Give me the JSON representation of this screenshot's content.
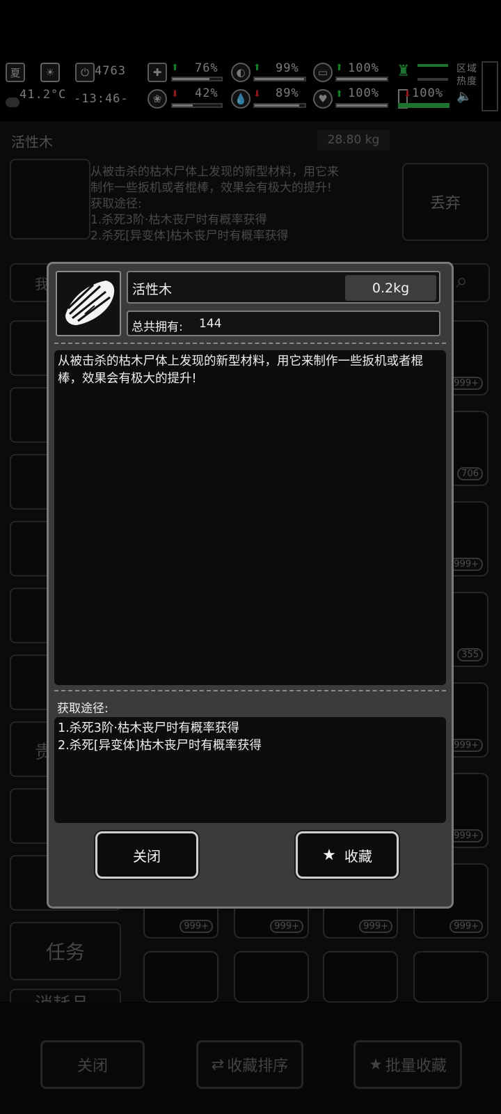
{
  "status": {
    "season": "夏",
    "temperature": "41.2°C",
    "time": "-13:46-",
    "counter": "4763",
    "stats": [
      {
        "icon": "medkit-icon",
        "value": "76%",
        "trend": "up"
      },
      {
        "icon": "stomach-icon",
        "value": "99%",
        "trend": "up"
      },
      {
        "icon": "bandage-icon",
        "value": "100%",
        "trend": "up"
      },
      {
        "icon": "brain-icon",
        "value": "42%",
        "trend": "down"
      },
      {
        "icon": "water-drop-icon",
        "value": "89%",
        "trend": "down"
      },
      {
        "icon": "heart-icon",
        "value": "100%",
        "trend": "up"
      },
      {
        "icon": "battery-icon",
        "value": "100%",
        "trend": "down"
      }
    ],
    "region_heat_label": "区域热度"
  },
  "background": {
    "item_name": "活性木",
    "item_weight": "28.80 kg",
    "desc_lines": [
      "从被击杀的枯木尸体上发现的新型材料，用它来",
      "制作一些扳机或者棍棒，效果会有极大的提升!",
      "获取途径:",
      "1.杀死3阶·枯木丧尸时有概率获得",
      "2.杀死[异变体]枯木丧尸时有概率获得"
    ],
    "discard_label": "丢弃",
    "search_stub": "我",
    "sidebar_task": "任务",
    "sidebar_consumable": "消耗品",
    "sidebar_valuable": "贵",
    "tile_counts": [
      "999+",
      "706",
      "999+",
      "355",
      "999+",
      "999+",
      "999+",
      "999+",
      "999+",
      "999+",
      "999+"
    ],
    "bottom_buttons": {
      "close": "关闭",
      "sort_favorites": "收藏排序",
      "batch_favorite": "批量收藏"
    }
  },
  "dialog": {
    "item_name": "活性木",
    "weight": "0.2kg",
    "owned_label": "总共拥有:",
    "owned_count": "144",
    "description": "从被击杀的枯木尸体上发现的新型材料，用它来制作一些扳机或者棍棒，效果会有极大的提升!",
    "source_title": "获取途径:",
    "sources": [
      "1.杀死3阶·枯木丧尸时有概率获得",
      "2.杀死[异变体]枯木丧尸时有概率获得"
    ],
    "close_label": "关闭",
    "favorite_label": "收藏"
  },
  "colors": {
    "up": "#1fbf3a",
    "down": "#d8262b",
    "bar_fill": "#b8b8b8",
    "bar_green": "#2bb34a"
  }
}
